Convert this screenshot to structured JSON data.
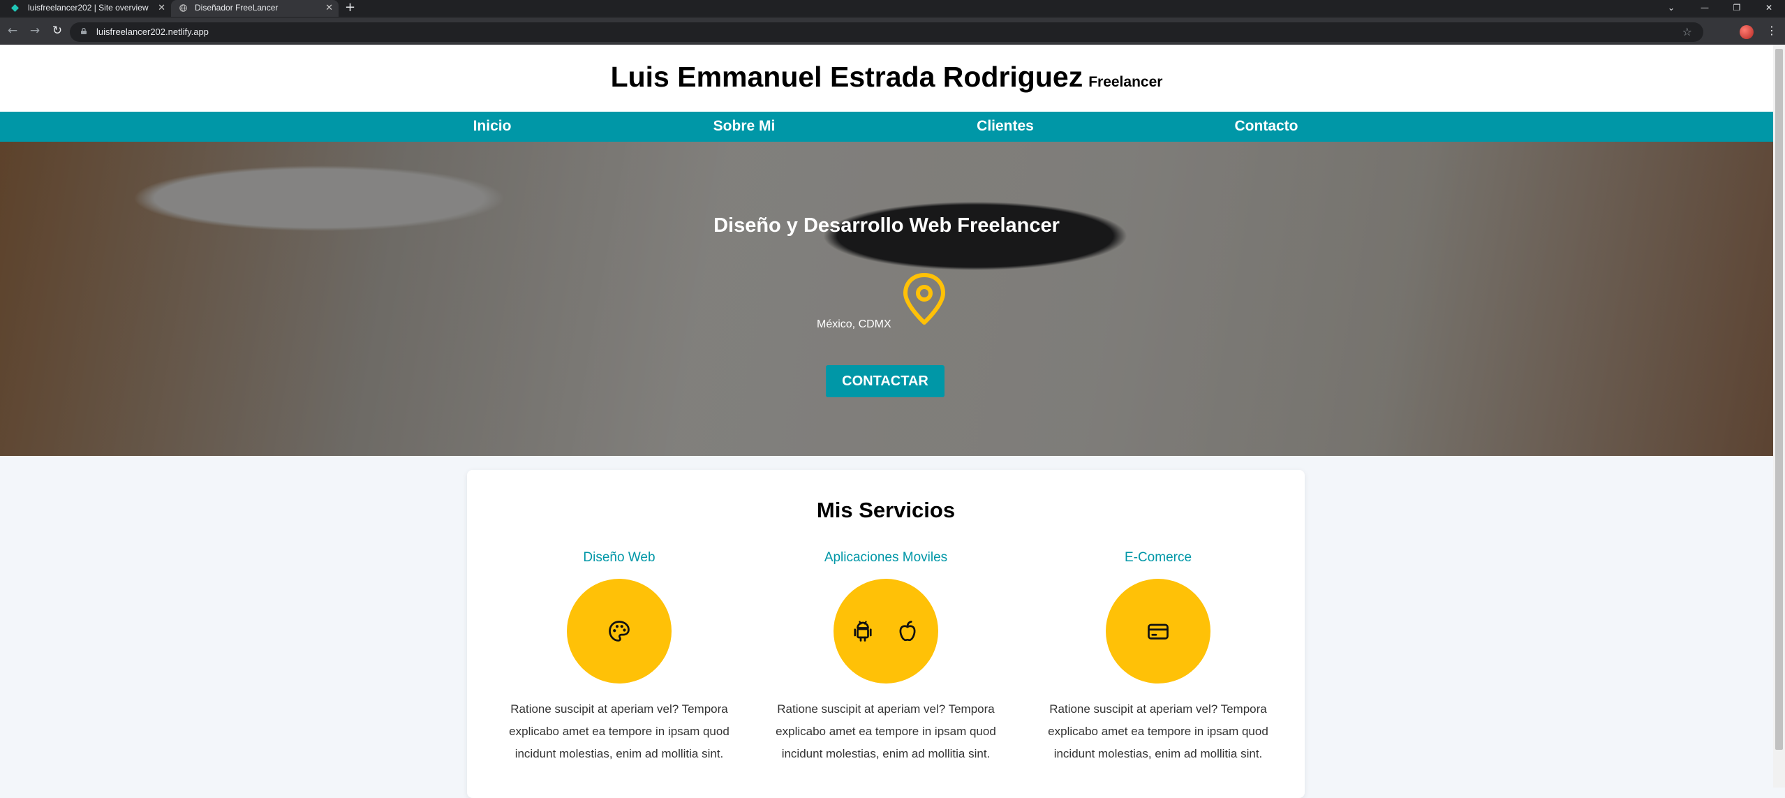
{
  "browser": {
    "tabs": [
      {
        "title": "luisfreelancer202 | Site overview",
        "active": false
      },
      {
        "title": "Diseñador FreeLancer",
        "active": true
      }
    ],
    "url": "luisfreelancer202.netlify.app"
  },
  "header": {
    "name": "Luis Emmanuel Estrada Rodriguez",
    "subtitle": "Freelancer"
  },
  "nav": {
    "items": [
      "Inicio",
      "Sobre Mi",
      "Clientes",
      "Contacto"
    ]
  },
  "hero": {
    "title": "Diseño y Desarrollo Web Freelancer",
    "location": "México, CDMX",
    "cta": "CONTACTAR",
    "icon": "map-pin-icon"
  },
  "services": {
    "title": "Mis Servicios",
    "items": [
      {
        "name": "Diseño Web",
        "description": "Ratione suscipit at aperiam vel? Tempora explicabo amet ea tempore in ipsam quod incidunt molestias, enim ad mollitia sint.",
        "icons": [
          "palette-icon"
        ]
      },
      {
        "name": "Aplicaciones Moviles",
        "description": "Ratione suscipit at aperiam vel? Tempora explicabo amet ea tempore in ipsam quod incidunt molestias, enim ad mollitia sint.",
        "icons": [
          "android-icon",
          "apple-icon"
        ]
      },
      {
        "name": "E-Comerce",
        "description": "Ratione suscipit at aperiam vel? Tempora explicabo amet ea tempore in ipsam quod incidunt molestias, enim ad mollitia sint.",
        "icons": [
          "credit-card-icon"
        ]
      }
    ]
  },
  "colors": {
    "primary": "#0097a7",
    "accent": "#ffc107",
    "page_background": "#f3f6fa"
  }
}
